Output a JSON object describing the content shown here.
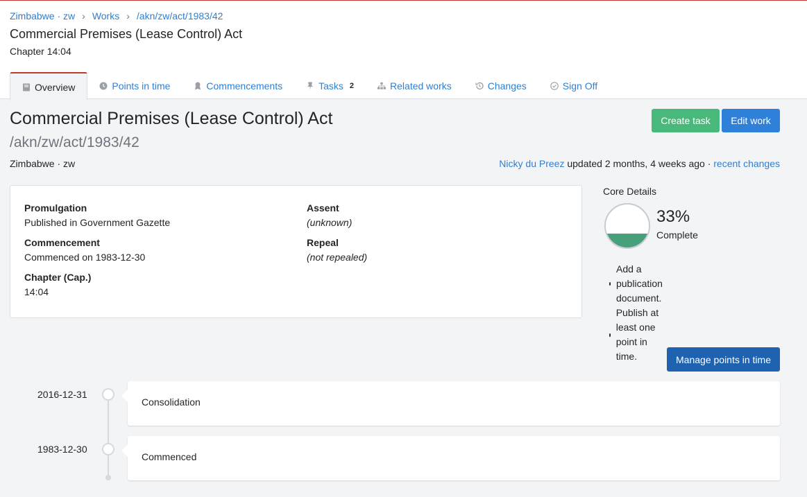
{
  "breadcrumb": {
    "items": [
      "Zimbabwe · zw",
      "Works",
      "/akn/zw/act/1983/42"
    ],
    "separator": "›"
  },
  "header": {
    "title": "Commercial Premises (Lease Control) Act",
    "subtitle": "Chapter 14:04"
  },
  "tabs": [
    {
      "label": "Overview",
      "icon": "book-icon",
      "active": true
    },
    {
      "label": "Points in time",
      "icon": "clock-icon"
    },
    {
      "label": "Commencements",
      "icon": "award-icon"
    },
    {
      "label": "Tasks",
      "icon": "pin-icon",
      "badge": "2"
    },
    {
      "label": "Related works",
      "icon": "sitemap-icon"
    },
    {
      "label": "Changes",
      "icon": "history-icon"
    },
    {
      "label": "Sign Off",
      "icon": "check-circle-icon"
    }
  ],
  "work": {
    "title": "Commercial Premises (Lease Control) Act",
    "frbr_uri": "/akn/zw/act/1983/42",
    "place": "Zimbabwe · zw"
  },
  "actions": {
    "create_task": "Create task",
    "edit_work": "Edit work",
    "manage_points": "Manage points in time"
  },
  "updated": {
    "user": "Nicky du Preez",
    "text": "updated 2 months, 4 weeks ago ·",
    "link": "recent changes"
  },
  "details": {
    "promulgation": {
      "label": "Promulgation",
      "value": "Published in Government Gazette"
    },
    "commencement": {
      "label": "Commencement",
      "value": "Commenced on 1983-12-30"
    },
    "chapter": {
      "label": "Chapter (Cap.)",
      "value": "14:04"
    },
    "assent": {
      "label": "Assent",
      "value": "(unknown)"
    },
    "repeal": {
      "label": "Repeal",
      "value": "(not repealed)"
    }
  },
  "core_details": {
    "title": "Core Details",
    "percent": 33,
    "percent_label": "33%",
    "complete_label": "Complete",
    "todos": [
      "Add a publication document.",
      "Publish at least one point in time."
    ]
  },
  "timeline": [
    {
      "date": "2016-12-31",
      "event": "Consolidation"
    },
    {
      "date": "1983-12-30",
      "event": "Commenced"
    }
  ],
  "colors": {
    "accent_red": "#c0392b",
    "link_blue": "#2e7fd1",
    "green": "#48b87b",
    "gauge_fill": "#48a07a",
    "navy": "#1f63b0"
  }
}
